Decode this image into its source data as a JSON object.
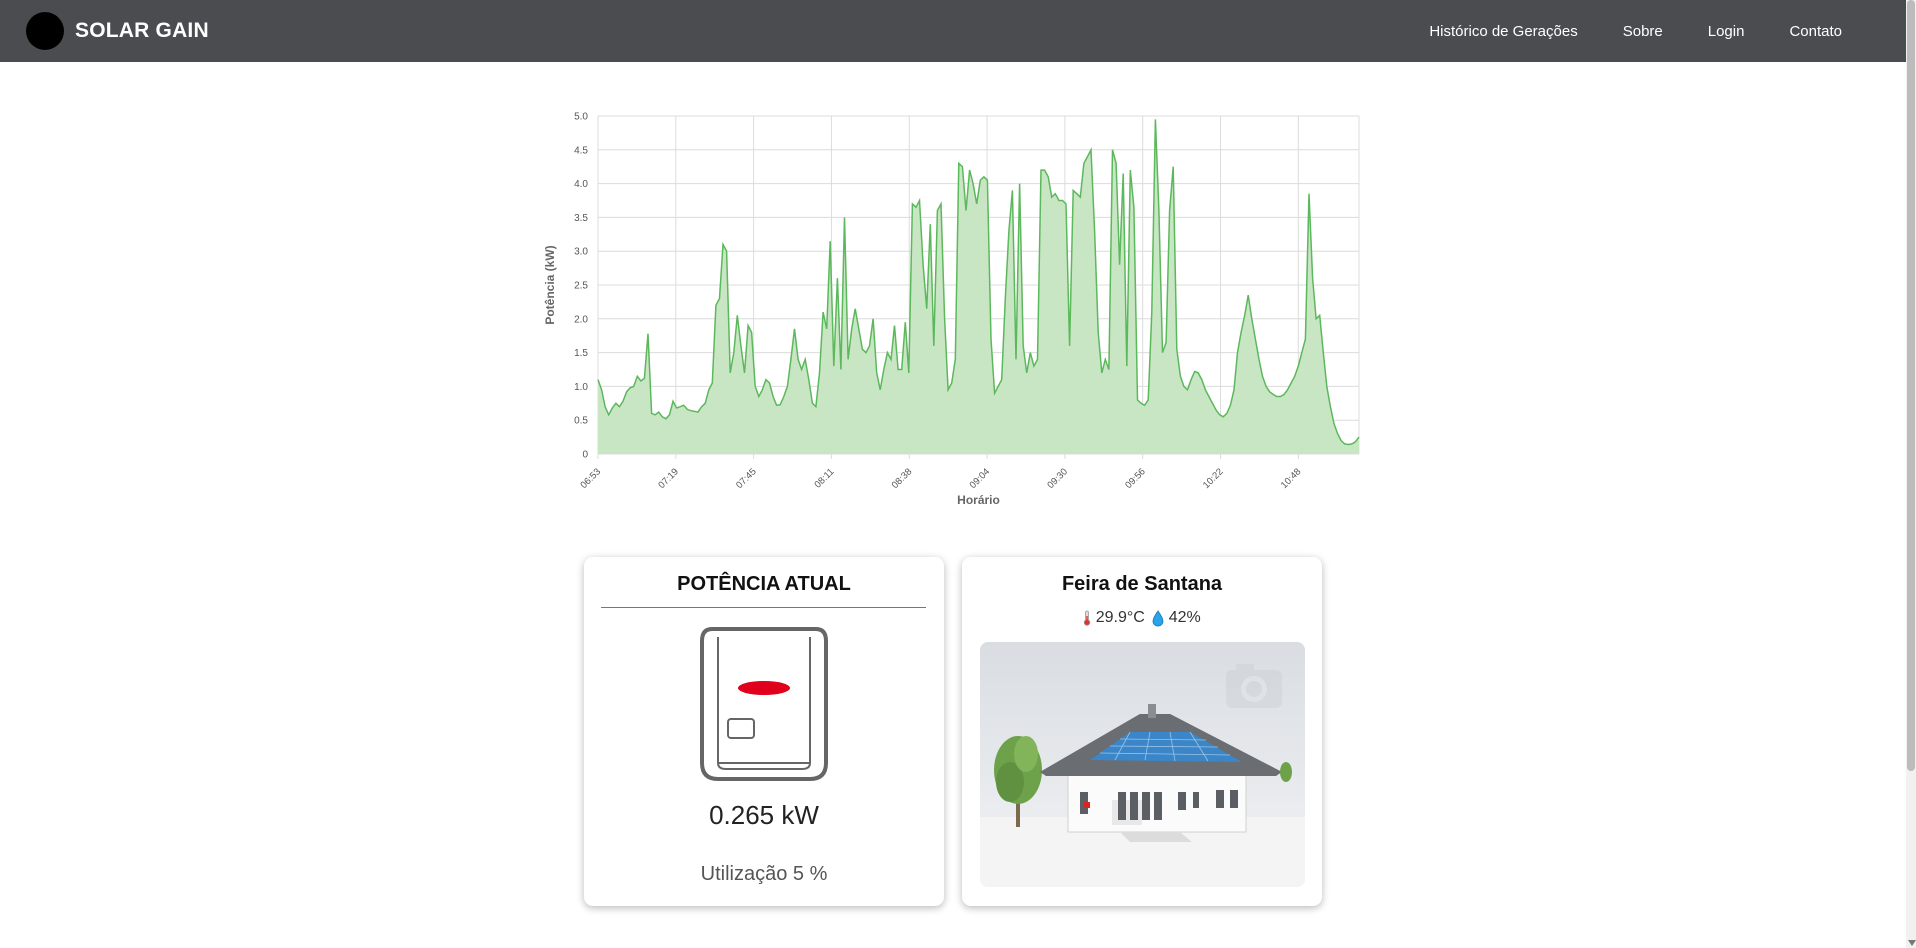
{
  "nav": {
    "brand": "SOLAR GAIN",
    "links": [
      "Histórico de Gerações",
      "Sobre",
      "Login",
      "Contato"
    ]
  },
  "chart_data": {
    "type": "area",
    "xlabel": "Horário",
    "ylabel": "Potência (kW)",
    "ylim": [
      0,
      5
    ],
    "yticks": [
      "0",
      "0.5",
      "1.0",
      "1.5",
      "2.0",
      "2.5",
      "3.0",
      "3.5",
      "4.0",
      "4.5",
      "5.0"
    ],
    "xticks": [
      "06:53",
      "07:19",
      "07:45",
      "08:11",
      "08:38",
      "09:04",
      "09:30",
      "09:56",
      "10:22",
      "10:48"
    ],
    "grid": true,
    "color": "#5cb85c",
    "fill": "#c9e6c4",
    "values": [
      1.1,
      0.95,
      0.7,
      0.58,
      0.68,
      0.75,
      0.7,
      0.78,
      0.92,
      0.98,
      1.0,
      1.15,
      1.08,
      1.12,
      1.78,
      0.6,
      0.58,
      0.62,
      0.55,
      0.52,
      0.58,
      0.78,
      0.68,
      0.7,
      0.72,
      0.66,
      0.64,
      0.63,
      0.62,
      0.7,
      0.75,
      0.95,
      1.05,
      2.2,
      2.3,
      3.1,
      3.0,
      1.2,
      1.5,
      2.05,
      1.6,
      1.2,
      1.9,
      1.8,
      1.0,
      0.85,
      0.95,
      1.1,
      1.05,
      0.85,
      0.72,
      0.73,
      0.85,
      1.0,
      1.4,
      1.85,
      1.4,
      1.25,
      1.4,
      1.1,
      0.75,
      0.7,
      1.2,
      2.1,
      1.85,
      3.15,
      1.3,
      2.6,
      1.25,
      3.5,
      1.4,
      1.85,
      2.15,
      1.85,
      1.55,
      1.5,
      1.6,
      2.0,
      1.2,
      0.95,
      1.25,
      1.5,
      1.4,
      1.9,
      1.25,
      1.25,
      1.95,
      1.2,
      3.7,
      3.65,
      3.75,
      2.8,
      2.15,
      3.4,
      1.6,
      3.6,
      3.7,
      2.0,
      0.95,
      1.05,
      1.4,
      4.3,
      4.25,
      3.6,
      4.2,
      4.0,
      3.7,
      4.05,
      4.1,
      4.05,
      1.7,
      0.9,
      1.0,
      1.1,
      2.3,
      3.3,
      3.9,
      1.4,
      4.0,
      1.6,
      1.2,
      1.5,
      1.3,
      1.4,
      4.2,
      4.2,
      4.1,
      3.8,
      3.85,
      3.75,
      3.75,
      3.7,
      1.6,
      3.9,
      3.85,
      3.8,
      4.3,
      4.4,
      4.5,
      3.3,
      1.8,
      1.2,
      1.4,
      1.25,
      4.5,
      4.3,
      2.8,
      4.15,
      1.3,
      4.2,
      3.65,
      0.8,
      0.75,
      0.72,
      0.8,
      2.1,
      4.95,
      3.6,
      1.5,
      1.65,
      3.6,
      4.25,
      1.55,
      1.15,
      1.0,
      0.95,
      1.1,
      1.22,
      1.2,
      1.1,
      0.95,
      0.85,
      0.75,
      0.65,
      0.58,
      0.55,
      0.6,
      0.72,
      0.95,
      1.5,
      1.8,
      2.05,
      2.35,
      2.0,
      1.7,
      1.4,
      1.15,
      1.0,
      0.92,
      0.88,
      0.85,
      0.85,
      0.88,
      0.95,
      1.05,
      1.15,
      1.3,
      1.5,
      1.7,
      3.85,
      2.6,
      2.0,
      2.05,
      1.5,
      1.0,
      0.7,
      0.45,
      0.3,
      0.2,
      0.15,
      0.14,
      0.15,
      0.18,
      0.25
    ]
  },
  "power_card": {
    "title": "POTÊNCIA ATUAL",
    "value": "0.265 kW",
    "utilization": "Utilização 5 %",
    "icon": "inverter-icon",
    "led_color": "#e0001b"
  },
  "weather_card": {
    "city": "Feira de Santana",
    "temperature": "29.9°C",
    "humidity": "42%",
    "temp_icon": "thermometer-icon",
    "humidity_icon": "droplet-icon",
    "photo": "house-with-solar-panels"
  }
}
